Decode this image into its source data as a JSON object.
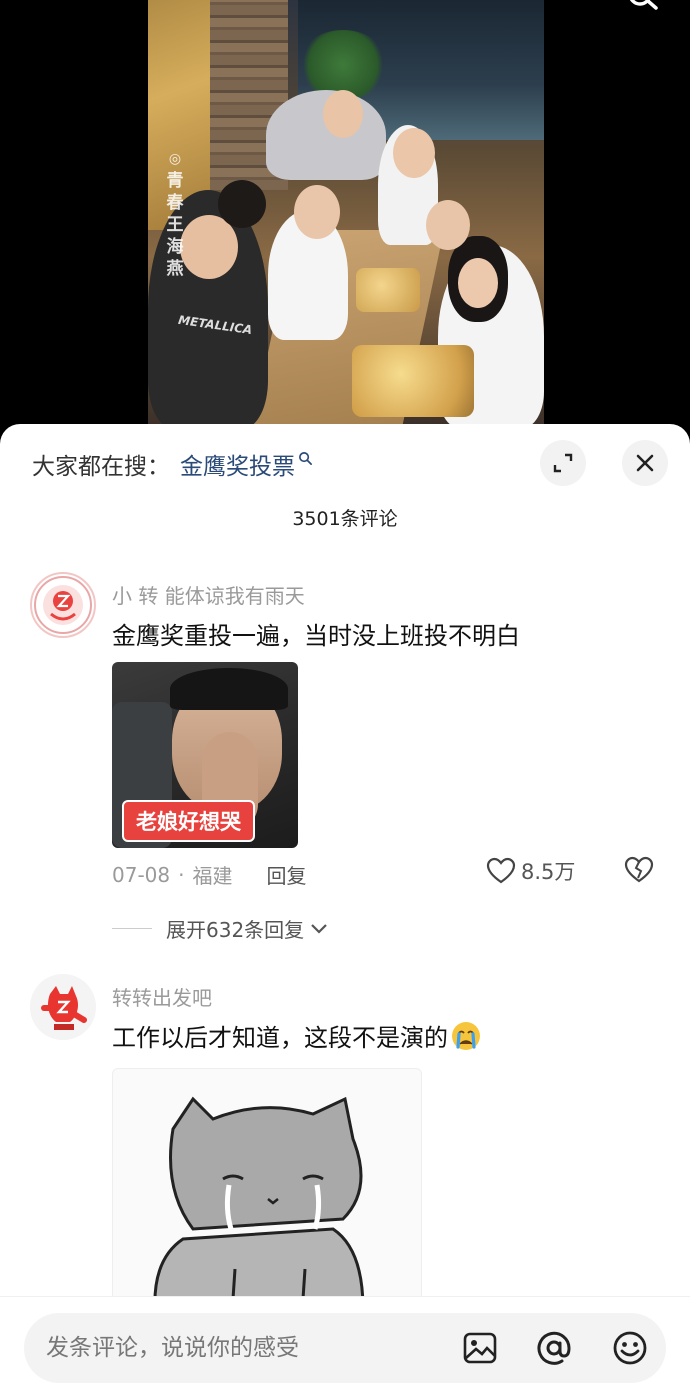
{
  "video": {
    "watermark": "青春王海燕",
    "shirt_text": "METALLICA"
  },
  "sheet": {
    "search_label": "大家都在搜：",
    "search_keyword": "金鹰奖投票",
    "comment_count": "3501条评论"
  },
  "comments": [
    {
      "user": "小 转  能体谅我有雨天",
      "text": "金鹰奖重投一遍，当时没上班投不明白",
      "sticker_text": "老娘好想哭",
      "date": "07-08",
      "dot": "·",
      "location": "福建",
      "reply_label": "回复",
      "likes": "8.5万",
      "expand_label": "展开632条回复"
    },
    {
      "user": "转转出发吧",
      "text": "工作以后才知道，这段不是演的"
    }
  ],
  "bottom": {
    "placeholder": "发条评论，说说你的感受"
  },
  "icons": [
    "search-icon",
    "expand-icon",
    "close-icon",
    "heart-icon",
    "broken-heart-icon",
    "chevron-down-icon",
    "image-icon",
    "at-icon",
    "smiley-icon",
    "crying-emoji-icon"
  ]
}
